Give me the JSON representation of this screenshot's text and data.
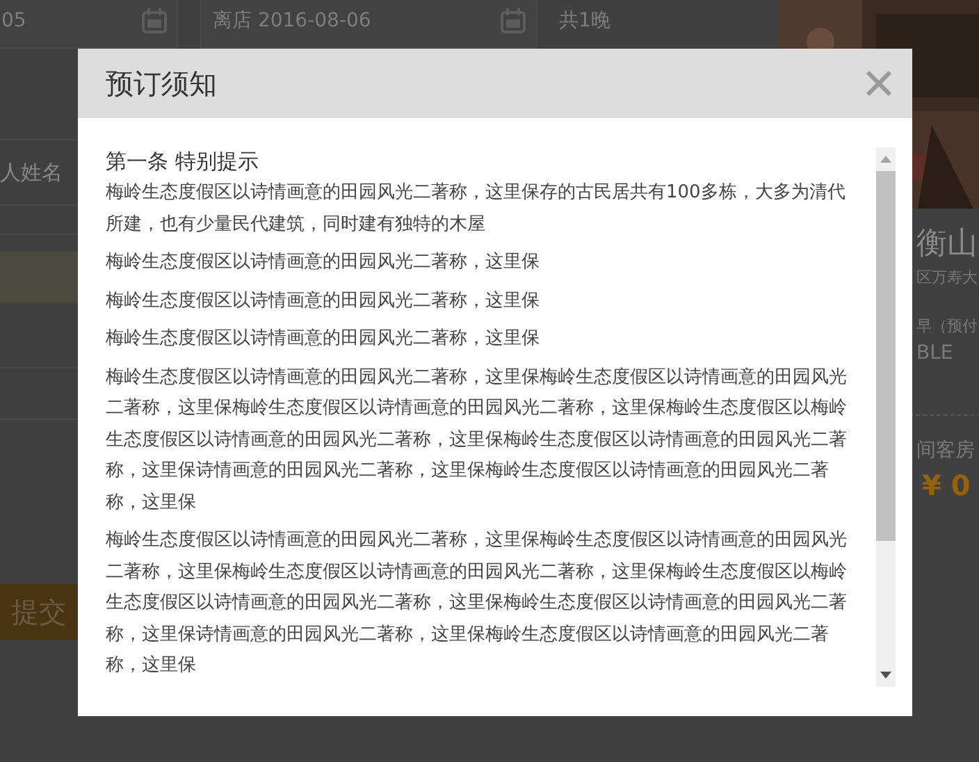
{
  "background_page": {
    "checkin_field": {
      "value": "05"
    },
    "checkout_field": {
      "value": "离店 2016-08-06"
    },
    "nights": "共1晚",
    "guest_name_label": "人姓名",
    "submit_button": "提交",
    "hotel_name": "衡山",
    "address": "区万寿大",
    "room_type": "早（预付",
    "bed_type": "BLE",
    "rooms_label": "间客房",
    "price": "¥ 0"
  },
  "dialog": {
    "title": "预订须知",
    "section_title": "第一条 特别提示",
    "paragraphs": [
      "梅岭生态度假区以诗情画意的田园风光二著称，这里保存的古民居共有100多栋，大多为清代所建，也有少量民代建筑，同时建有独特的木屋",
      "梅岭生态度假区以诗情画意的田园风光二著称，这里保",
      "梅岭生态度假区以诗情画意的田园风光二著称，这里保",
      "梅岭生态度假区以诗情画意的田园风光二著称，这里保",
      "梅岭生态度假区以诗情画意的田园风光二著称，这里保梅岭生态度假区以诗情画意的田园风光二著称，这里保梅岭生态度假区以诗情画意的田园风光二著称，这里保梅岭生态度假区以梅岭生态度假区以诗情画意的田园风光二著称，这里保梅岭生态度假区以诗情画意的田园风光二著称，这里保诗情画意的田园风光二著称，这里保梅岭生态度假区以诗情画意的田园风光二著称，这里保",
      "梅岭生态度假区以诗情画意的田园风光二著称，这里保梅岭生态度假区以诗情画意的田园风光二著称，这里保梅岭生态度假区以诗情画意的田园风光二著称，这里保梅岭生态度假区以梅岭生态度假区以诗情画意的田园风光二著称，这里保梅岭生态度假区以诗情画意的田园风光二著称，这里保诗情画意的田园风光二著称，这里保梅岭生态度假区以诗情画意的田园风光二著称，这里保"
    ]
  }
}
